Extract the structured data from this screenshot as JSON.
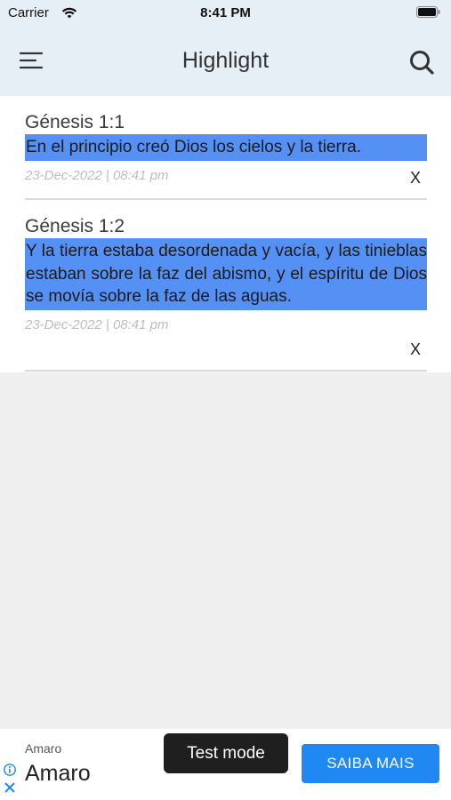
{
  "status_bar": {
    "carrier": "Carrier",
    "time": "8:41 PM",
    "wifi_icon": "wifi-icon",
    "battery_icon": "battery-icon"
  },
  "header": {
    "title": "Highlight",
    "menu_icon": "menu-icon",
    "search_icon": "search-icon",
    "background": "#e6eef6"
  },
  "highlights": [
    {
      "reference": "Génesis 1:1",
      "text": "En el principio creó Dios los cielos y la tierra.",
      "date": "23-Dec-2022 | 08:41 pm",
      "remove_label": "X"
    },
    {
      "reference": "Génesis 1:2",
      "text": "Y la tierra estaba desordenada y vacía, y las tinieblas estaban sobre la faz del abismo, y el espíritu de Dios se movía sobre la faz de las aguas.",
      "date": "23-Dec-2022 | 08:41 pm",
      "remove_label": "X"
    }
  ],
  "highlight_color": "#5591f5",
  "ad": {
    "advertiser_small": "Amaro",
    "advertiser_big": "Amaro",
    "test_mode_label": "Test mode",
    "cta_label": "SAIBA MAIS",
    "cta_color": "#1f88f2",
    "info_icon": "info-icon",
    "close_icon": "close-icon"
  }
}
